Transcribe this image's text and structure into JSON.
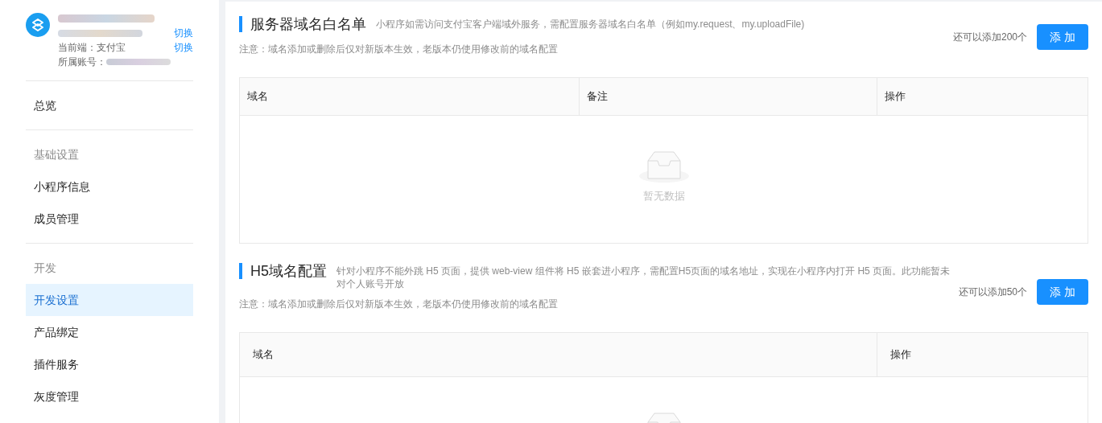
{
  "sidebar": {
    "account": {
      "switch_links": [
        "切换",
        "切换"
      ],
      "current_client": "当前端：支付宝",
      "account_label": "所属账号："
    },
    "groups": [
      {
        "items": [
          {
            "label": "总览",
            "selected": false
          }
        ]
      },
      {
        "header": "基础设置",
        "items": [
          {
            "label": "小程序信息",
            "selected": false
          },
          {
            "label": "成员管理",
            "selected": false
          }
        ]
      },
      {
        "header": "开发",
        "items": [
          {
            "label": "开发设置",
            "selected": true
          },
          {
            "label": "产品绑定",
            "selected": false
          },
          {
            "label": "插件服务",
            "selected": false
          },
          {
            "label": "灰度管理",
            "selected": false
          }
        ]
      }
    ]
  },
  "sections": [
    {
      "title": "服务器域名白名单",
      "description": "小程序如需访问支付宝客户端域外服务，需配置服务器域名白名单（例如my.request、my.uploadFile)",
      "note": "注意：域名添加或删除后仅对新版本生效，老版本仍使用修改前的域名配置",
      "quota": "还可以添加200个",
      "add_button": "添 加",
      "columns": [
        "域名",
        "备注",
        "操作"
      ],
      "empty_text": "暂无数据"
    },
    {
      "title": "H5域名配置",
      "description": "针对小程序不能外跳 H5 页面，提供 web-view 组件将 H5 嵌套进小程序，需配置H5页面的域名地址，实现在小程序内打开 H5 页面。此功能暂未对个人账号开放",
      "note": "注意：域名添加或删除后仅对新版本生效，老版本仍使用修改前的域名配置",
      "quota": "还可以添加50个",
      "add_button": "添 加",
      "columns": [
        "域名",
        "操作"
      ]
    }
  ]
}
